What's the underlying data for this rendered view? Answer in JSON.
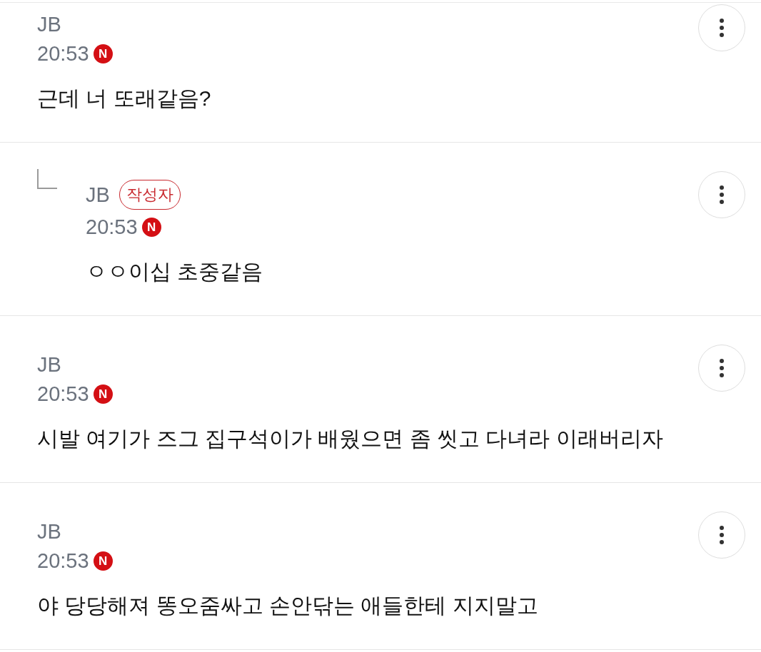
{
  "comments": [
    {
      "reply": false,
      "author": "JB",
      "time": "20:53",
      "new_badge": "N",
      "text": "근데 너 또래같음?"
    },
    {
      "reply": true,
      "author": "JB",
      "author_badge": "작성자",
      "time": "20:53",
      "new_badge": "N",
      "text": "ㅇㅇ이십 초중같음"
    },
    {
      "reply": false,
      "author": "JB",
      "time": "20:53",
      "new_badge": "N",
      "text": "시발 여기가 즈그 집구석이가 배웠으면 좀 씻고 다녀라 이래버리자"
    },
    {
      "reply": false,
      "author": "JB",
      "time": "20:53",
      "new_badge": "N",
      "text": "야 당당해져 똥오줌싸고 손안닦는 애들한테 지지말고"
    }
  ]
}
